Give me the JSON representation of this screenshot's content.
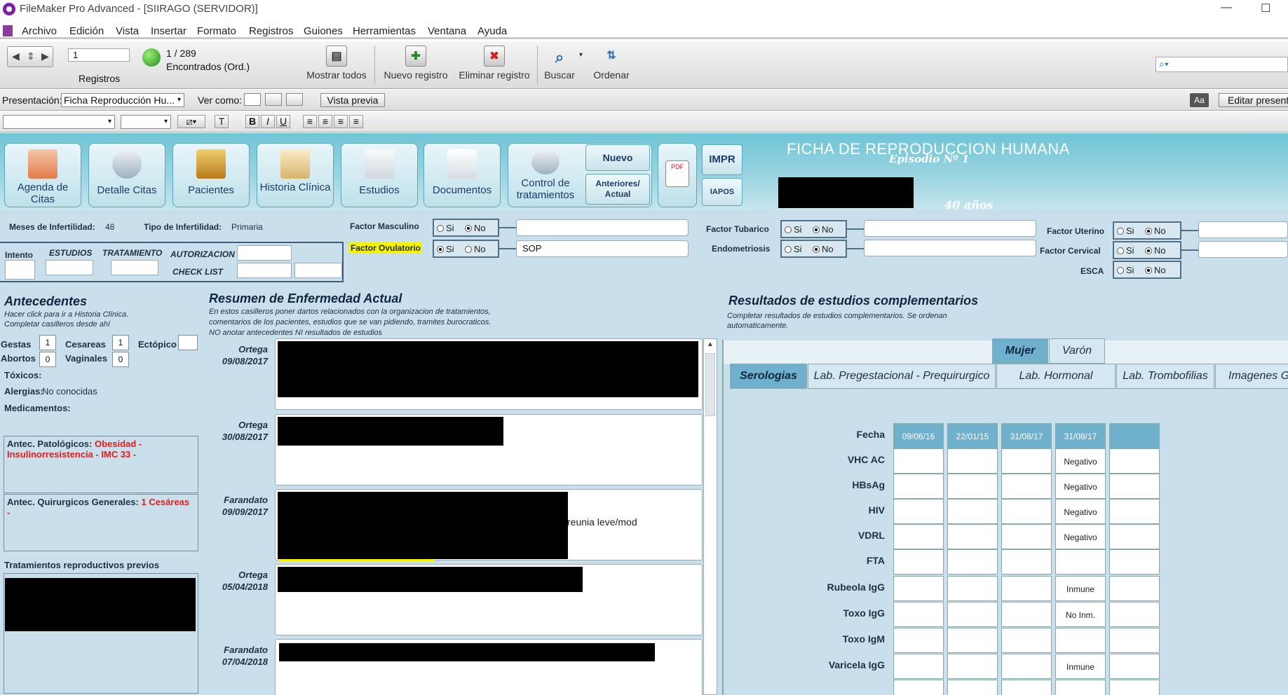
{
  "window": {
    "title": "FileMaker Pro Advanced - [SIIRAGO (SERVIDOR)]"
  },
  "menu": [
    "Archivo",
    "Edición",
    "Vista",
    "Insertar",
    "Formato",
    "Registros",
    "Guiones",
    "Herramientas",
    "Ventana",
    "Ayuda"
  ],
  "toolbar": {
    "record_number": "1",
    "records_label": "Registros",
    "count": "1 / 289",
    "found": "Encontrados (Ord.)",
    "show_all": "Mostrar todos",
    "new_record": "Nuevo registro",
    "delete_record": "Eliminar registro",
    "find": "Buscar",
    "sort": "Ordenar"
  },
  "layoutbar": {
    "presentation_label": "Presentación:",
    "presentation_value": "Ficha Reproducción Hu...",
    "view_as_label": "Ver como:",
    "preview": "Vista previa",
    "aa": "Aa",
    "edit_layout": "Editar present"
  },
  "header": {
    "tiles": [
      "Agenda de Citas",
      "Detalle Citas",
      "Pacientes",
      "Historia Clínica",
      "Estudios",
      "Documentos",
      "Control de tratamientos"
    ],
    "nuevo": "Nuevo",
    "anteriores": "Anteriores/ Actual",
    "pdf": "PDF",
    "impr": "IMPR",
    "iapos": "IAPOS",
    "title": "FICHA DE REPRODUCCION HUMANA",
    "episode": "Episodio Nº  1",
    "age": "40 años"
  },
  "infertility": {
    "months_label": "Meses de Infertilidad:",
    "months_value": "48",
    "type_label": "Tipo de Infertilidad:",
    "type_value": "Primaria"
  },
  "intento": {
    "intento": "Intento",
    "estudios": "ESTUDIOS",
    "tratamiento": "TRATAMIENTO",
    "autorizacion": "AUTORIZACION",
    "checklist": "CHECK LIST"
  },
  "factors": {
    "masculino": {
      "label": "Factor Masculino",
      "si": "Si",
      "no": "No",
      "selected": "No",
      "text": ""
    },
    "ovulatorio": {
      "label": "Factor Ovulatorio",
      "si": "Si",
      "no": "No",
      "selected": "Si",
      "text": "SOP"
    },
    "tubarico": {
      "label": "Factor Tubarico",
      "si": "Si",
      "no": "No",
      "selected": "No",
      "text": ""
    },
    "endometriosis": {
      "label": "Endometriosis",
      "si": "Si",
      "no": "No",
      "selected": "No",
      "text": ""
    },
    "uterino": {
      "label": "Factor Uterino",
      "si": "Si",
      "no": "No",
      "selected": "No",
      "text": ""
    },
    "cervical": {
      "label": "Factor Cervical",
      "si": "Si",
      "no": "No",
      "selected": "No",
      "text": ""
    },
    "esca": {
      "label": "ESCA",
      "si": "Si",
      "no": "No",
      "selected": "No"
    }
  },
  "antecedentes": {
    "title": "Antecedentes",
    "hint1": "Hacer click para ir a Historia Clínica.",
    "hint2": "Completar casilleros desde ahí",
    "gestas_label": "Gestas",
    "gestas": "1",
    "cesareas_label": "Cesareas",
    "cesareas": "1",
    "ectopico_label": "Ectópico",
    "ectopico": "",
    "abortos_label": "Abortos",
    "abortos": "0",
    "vaginales_label": "Vaginales",
    "vaginales": "0",
    "toxicos_label": "Tóxicos:",
    "alergias_label": "Alergias:",
    "alergias": "No conocidas",
    "medicamentos_label": "Medicamentos:",
    "patologicos_label": "Antec. Patológicos:",
    "patologicos_value_a": "Obesidad -",
    "patologicos_value_b": "Insulinorresistencia -  IMC 33 -",
    "quirurgicos_label": "Antec. Quirurgicos Generales:",
    "quirurgicos_value": "1 Cesáreas -",
    "tratamientos_label": "Tratamientos reproductivos previos"
  },
  "resumen": {
    "title": "Resumen de Enfermedad Actual",
    "hint1": "En estos casilleros poner dartos relacionados con la organizacion de tratamientos,",
    "hint2": "comentarios de los pacientes, estudios que se van pidiendo, tramites burocraticos.",
    "hint3": "NO anotar antecedentes NI resultados de estudios",
    "entries": [
      {
        "author": "Ortega",
        "date": "09/08/2017",
        "text": ""
      },
      {
        "author": "Ortega",
        "date": "30/08/2017",
        "text": ""
      },
      {
        "author": "Farandato",
        "date": "09/09/2017",
        "text": "reunia leve/mod"
      },
      {
        "author": "Ortega",
        "date": "05/04/2018",
        "text": ""
      },
      {
        "author": "Farandato",
        "date": "07/04/2018",
        "text": ""
      }
    ]
  },
  "resultados": {
    "title": "Resultados de estudios complementarios",
    "hint1": "Completar resultados de estudios complementarios.  Se ordenan",
    "hint2": "automaticamente.",
    "gender_tabs": [
      "Mujer",
      "Varón"
    ],
    "tabs": [
      "Serologias",
      "Lab. Pregestacional - Prequirurgico",
      "Lab. Hormonal",
      "Lab. Trombofilias",
      "Imagenes Gi"
    ],
    "fecha_label": "Fecha",
    "dates": [
      "09/06/16",
      "22/01/15",
      "31/08/17",
      "31/08/17",
      ""
    ],
    "rows": [
      {
        "label": "VHC AC",
        "values": [
          "",
          "",
          "",
          "Negativo",
          ""
        ]
      },
      {
        "label": "HBsAg",
        "values": [
          "",
          "",
          "",
          "Negativo",
          ""
        ]
      },
      {
        "label": "HIV",
        "values": [
          "",
          "",
          "",
          "Negativo",
          ""
        ]
      },
      {
        "label": "VDRL",
        "values": [
          "",
          "",
          "",
          "Negativo",
          ""
        ]
      },
      {
        "label": "FTA",
        "values": [
          "",
          "",
          "",
          "",
          ""
        ]
      },
      {
        "label": "Rubeola IgG",
        "values": [
          "",
          "",
          "",
          "Inmune",
          ""
        ]
      },
      {
        "label": "Toxo IgG",
        "values": [
          "",
          "",
          "",
          "No Inm.",
          ""
        ]
      },
      {
        "label": "Toxo IgM",
        "values": [
          "",
          "",
          "",
          "",
          ""
        ]
      },
      {
        "label": "Varicela IgG",
        "values": [
          "",
          "",
          "",
          "Inmune",
          ""
        ]
      }
    ]
  }
}
